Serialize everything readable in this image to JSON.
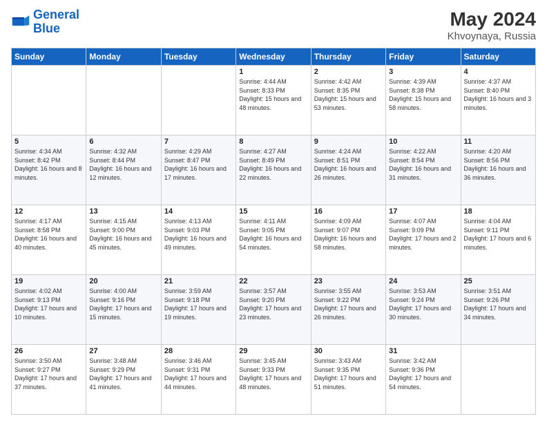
{
  "header": {
    "logo_line1": "General",
    "logo_line2": "Blue",
    "month_year": "May 2024",
    "location": "Khvoynaya, Russia"
  },
  "weekdays": [
    "Sunday",
    "Monday",
    "Tuesday",
    "Wednesday",
    "Thursday",
    "Friday",
    "Saturday"
  ],
  "weeks": [
    [
      {
        "day": "",
        "sunrise": "",
        "sunset": "",
        "daylight": ""
      },
      {
        "day": "",
        "sunrise": "",
        "sunset": "",
        "daylight": ""
      },
      {
        "day": "",
        "sunrise": "",
        "sunset": "",
        "daylight": ""
      },
      {
        "day": "1",
        "sunrise": "Sunrise: 4:44 AM",
        "sunset": "Sunset: 8:33 PM",
        "daylight": "Daylight: 15 hours and 48 minutes."
      },
      {
        "day": "2",
        "sunrise": "Sunrise: 4:42 AM",
        "sunset": "Sunset: 8:35 PM",
        "daylight": "Daylight: 15 hours and 53 minutes."
      },
      {
        "day": "3",
        "sunrise": "Sunrise: 4:39 AM",
        "sunset": "Sunset: 8:38 PM",
        "daylight": "Daylight: 15 hours and 58 minutes."
      },
      {
        "day": "4",
        "sunrise": "Sunrise: 4:37 AM",
        "sunset": "Sunset: 8:40 PM",
        "daylight": "Daylight: 16 hours and 3 minutes."
      }
    ],
    [
      {
        "day": "5",
        "sunrise": "Sunrise: 4:34 AM",
        "sunset": "Sunset: 8:42 PM",
        "daylight": "Daylight: 16 hours and 8 minutes."
      },
      {
        "day": "6",
        "sunrise": "Sunrise: 4:32 AM",
        "sunset": "Sunset: 8:44 PM",
        "daylight": "Daylight: 16 hours and 12 minutes."
      },
      {
        "day": "7",
        "sunrise": "Sunrise: 4:29 AM",
        "sunset": "Sunset: 8:47 PM",
        "daylight": "Daylight: 16 hours and 17 minutes."
      },
      {
        "day": "8",
        "sunrise": "Sunrise: 4:27 AM",
        "sunset": "Sunset: 8:49 PM",
        "daylight": "Daylight: 16 hours and 22 minutes."
      },
      {
        "day": "9",
        "sunrise": "Sunrise: 4:24 AM",
        "sunset": "Sunset: 8:51 PM",
        "daylight": "Daylight: 16 hours and 26 minutes."
      },
      {
        "day": "10",
        "sunrise": "Sunrise: 4:22 AM",
        "sunset": "Sunset: 8:54 PM",
        "daylight": "Daylight: 16 hours and 31 minutes."
      },
      {
        "day": "11",
        "sunrise": "Sunrise: 4:20 AM",
        "sunset": "Sunset: 8:56 PM",
        "daylight": "Daylight: 16 hours and 36 minutes."
      }
    ],
    [
      {
        "day": "12",
        "sunrise": "Sunrise: 4:17 AM",
        "sunset": "Sunset: 8:58 PM",
        "daylight": "Daylight: 16 hours and 40 minutes."
      },
      {
        "day": "13",
        "sunrise": "Sunrise: 4:15 AM",
        "sunset": "Sunset: 9:00 PM",
        "daylight": "Daylight: 16 hours and 45 minutes."
      },
      {
        "day": "14",
        "sunrise": "Sunrise: 4:13 AM",
        "sunset": "Sunset: 9:03 PM",
        "daylight": "Daylight: 16 hours and 49 minutes."
      },
      {
        "day": "15",
        "sunrise": "Sunrise: 4:11 AM",
        "sunset": "Sunset: 9:05 PM",
        "daylight": "Daylight: 16 hours and 54 minutes."
      },
      {
        "day": "16",
        "sunrise": "Sunrise: 4:09 AM",
        "sunset": "Sunset: 9:07 PM",
        "daylight": "Daylight: 16 hours and 58 minutes."
      },
      {
        "day": "17",
        "sunrise": "Sunrise: 4:07 AM",
        "sunset": "Sunset: 9:09 PM",
        "daylight": "Daylight: 17 hours and 2 minutes."
      },
      {
        "day": "18",
        "sunrise": "Sunrise: 4:04 AM",
        "sunset": "Sunset: 9:11 PM",
        "daylight": "Daylight: 17 hours and 6 minutes."
      }
    ],
    [
      {
        "day": "19",
        "sunrise": "Sunrise: 4:02 AM",
        "sunset": "Sunset: 9:13 PM",
        "daylight": "Daylight: 17 hours and 10 minutes."
      },
      {
        "day": "20",
        "sunrise": "Sunrise: 4:00 AM",
        "sunset": "Sunset: 9:16 PM",
        "daylight": "Daylight: 17 hours and 15 minutes."
      },
      {
        "day": "21",
        "sunrise": "Sunrise: 3:59 AM",
        "sunset": "Sunset: 9:18 PM",
        "daylight": "Daylight: 17 hours and 19 minutes."
      },
      {
        "day": "22",
        "sunrise": "Sunrise: 3:57 AM",
        "sunset": "Sunset: 9:20 PM",
        "daylight": "Daylight: 17 hours and 23 minutes."
      },
      {
        "day": "23",
        "sunrise": "Sunrise: 3:55 AM",
        "sunset": "Sunset: 9:22 PM",
        "daylight": "Daylight: 17 hours and 26 minutes."
      },
      {
        "day": "24",
        "sunrise": "Sunrise: 3:53 AM",
        "sunset": "Sunset: 9:24 PM",
        "daylight": "Daylight: 17 hours and 30 minutes."
      },
      {
        "day": "25",
        "sunrise": "Sunrise: 3:51 AM",
        "sunset": "Sunset: 9:26 PM",
        "daylight": "Daylight: 17 hours and 34 minutes."
      }
    ],
    [
      {
        "day": "26",
        "sunrise": "Sunrise: 3:50 AM",
        "sunset": "Sunset: 9:27 PM",
        "daylight": "Daylight: 17 hours and 37 minutes."
      },
      {
        "day": "27",
        "sunrise": "Sunrise: 3:48 AM",
        "sunset": "Sunset: 9:29 PM",
        "daylight": "Daylight: 17 hours and 41 minutes."
      },
      {
        "day": "28",
        "sunrise": "Sunrise: 3:46 AM",
        "sunset": "Sunset: 9:31 PM",
        "daylight": "Daylight: 17 hours and 44 minutes."
      },
      {
        "day": "29",
        "sunrise": "Sunrise: 3:45 AM",
        "sunset": "Sunset: 9:33 PM",
        "daylight": "Daylight: 17 hours and 48 minutes."
      },
      {
        "day": "30",
        "sunrise": "Sunrise: 3:43 AM",
        "sunset": "Sunset: 9:35 PM",
        "daylight": "Daylight: 17 hours and 51 minutes."
      },
      {
        "day": "31",
        "sunrise": "Sunrise: 3:42 AM",
        "sunset": "Sunset: 9:36 PM",
        "daylight": "Daylight: 17 hours and 54 minutes."
      },
      {
        "day": "",
        "sunrise": "",
        "sunset": "",
        "daylight": ""
      }
    ]
  ]
}
